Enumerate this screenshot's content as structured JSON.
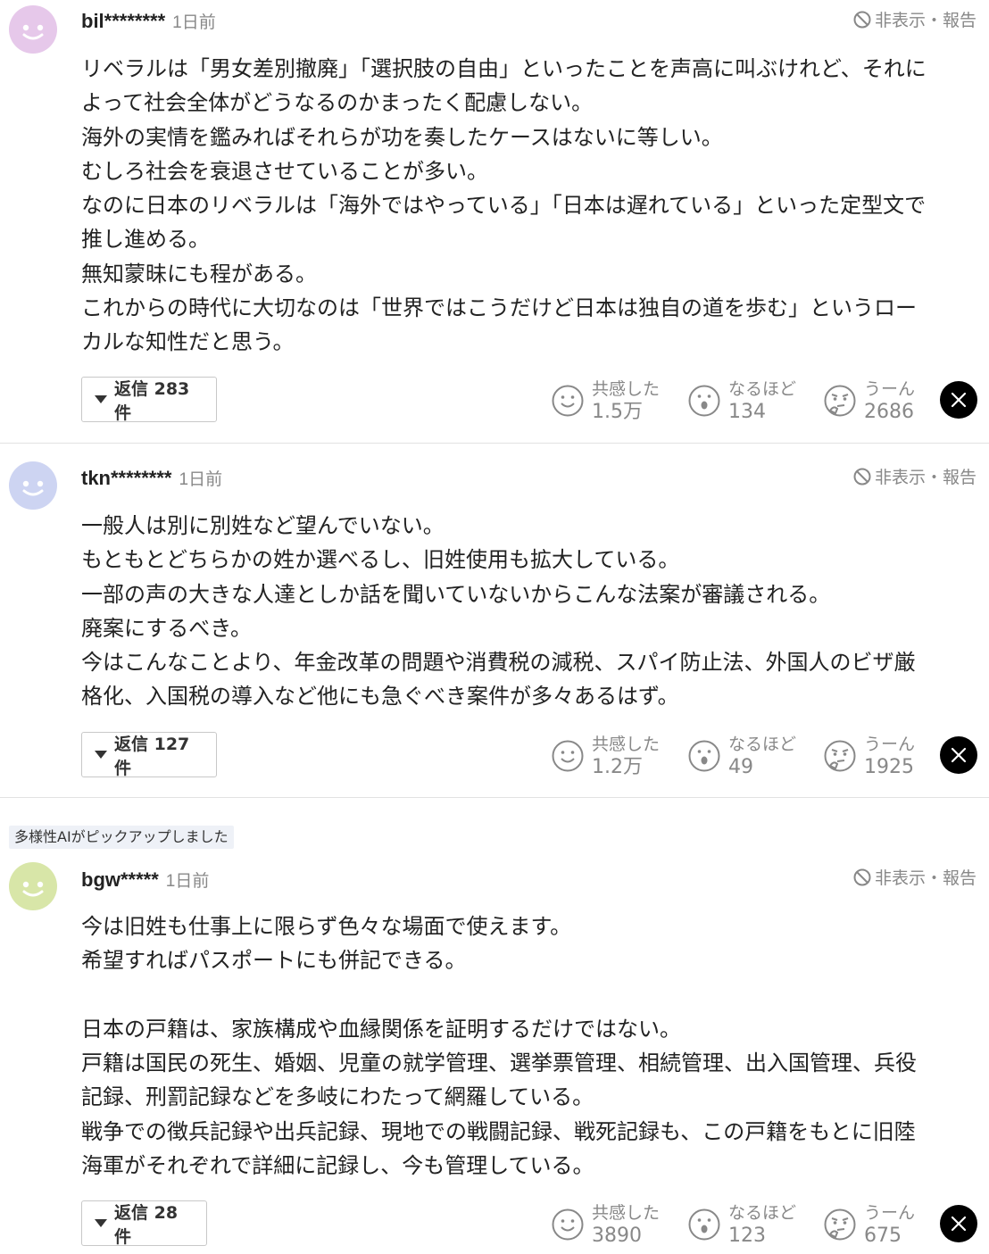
{
  "colors": {
    "avatar1": "#e6c8ea",
    "avatar2": "#cdd4f2",
    "avatar3": "#d8e6a8",
    "muted": "#888888"
  },
  "pickup_label": "多様性AIがピックアップしました",
  "comments": [
    {
      "username": "bil********",
      "time": "1日前",
      "report": "非表示・報告",
      "body": "リベラルは「男女差別撤廃」「選択肢の自由」といったことを声高に叫ぶけれど、それに\nよって社会全体がどうなるのかまったく配慮しない。\n海外の実情を鑑みればそれらが功を奏したケースはないに等しい。\nむしろ社会を衰退させていることが多い。\nなのに日本のリベラルは「海外ではやっている」「日本は遅れている」といった定型文で\n推し進める。\n無知蒙昧にも程がある。\nこれからの時代に大切なのは「世界ではこうだけど日本は独自の道を歩む」というロー\nカルな知性だと思う。",
      "reply_label": "返信 283件",
      "reactions": [
        {
          "label": "共感した",
          "count": "1.5万",
          "icon": "smile-face-icon"
        },
        {
          "label": "なるほど",
          "count": "134",
          "icon": "surprised-face-icon"
        },
        {
          "label": "うーん",
          "count": "2686",
          "icon": "thinking-face-icon"
        }
      ],
      "share_icon": "x-logo-icon"
    },
    {
      "username": "tkn********",
      "time": "1日前",
      "report": "非表示・報告",
      "body": "一般人は別に別姓など望んでいない。\nもともとどちらかの姓か選べるし、旧姓使用も拡大している。\n一部の声の大きな人達としか話を聞いていないからこんな法案が審議される。\n廃案にするべき。\n今はこんなことより、年金改革の問題や消費税の減税、スパイ防止法、外国人のビザ厳\n格化、入国税の導入など他にも急ぐべき案件が多々あるはず。",
      "reply_label": "返信 127件",
      "reactions": [
        {
          "label": "共感した",
          "count": "1.2万",
          "icon": "smile-face-icon"
        },
        {
          "label": "なるほど",
          "count": "49",
          "icon": "surprised-face-icon"
        },
        {
          "label": "うーん",
          "count": "1925",
          "icon": "thinking-face-icon"
        }
      ],
      "share_icon": "x-logo-icon"
    },
    {
      "username": "bgw*****",
      "time": "1日前",
      "report": "非表示・報告",
      "body": "今は旧姓も仕事上に限らず色々な場面で使えます。\n希望すればパスポートにも併記できる。\n\n日本の戸籍は、家族構成や血縁関係を証明するだけではない。\n戸籍は国民の死生、婚姻、児童の就学管理、選挙票管理、相続管理、出入国管理、兵役\n記録、刑罰記録などを多岐にわたって網羅している。\n戦争での徴兵記録や出兵記録、現地での戦闘記録、戦死記録も、この戸籍をもとに旧陸\n海軍がそれぞれで詳細に記録し、今も管理している。",
      "reply_label": "返信 28件",
      "reactions": [
        {
          "label": "共感した",
          "count": "3890",
          "icon": "smile-face-icon"
        },
        {
          "label": "なるほど",
          "count": "123",
          "icon": "surprised-face-icon"
        },
        {
          "label": "うーん",
          "count": "675",
          "icon": "thinking-face-icon"
        }
      ],
      "share_icon": "x-logo-icon"
    }
  ]
}
